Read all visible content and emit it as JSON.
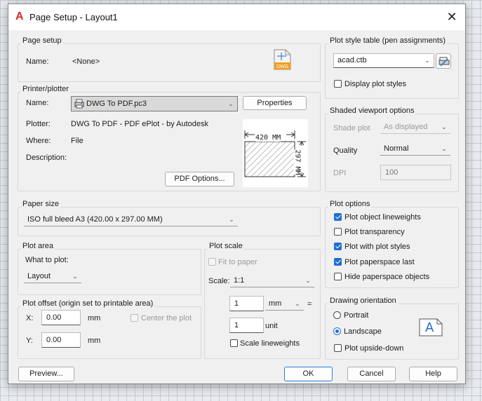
{
  "window": {
    "title": "Page Setup - Layout1",
    "logo": "A",
    "close_glyph": "✕"
  },
  "page_setup": {
    "group": "Page setup",
    "name_label": "Name:",
    "name_value": "<None>",
    "file_icon_text": "DWG"
  },
  "printer": {
    "group": "Printer/plotter",
    "name_label": "Name:",
    "name_value": "DWG To PDF.pc3",
    "properties_btn": "Properties",
    "plotter_label": "Plotter:",
    "plotter_value": "DWG To PDF - PDF ePlot - by Autodesk",
    "where_label": "Where:",
    "where_value": "File",
    "description_label": "Description:",
    "pdf_options_btn": "PDF Options...",
    "preview_width": "420  MM",
    "preview_height": "297  MM"
  },
  "paper_size": {
    "group": "Paper size",
    "value": "ISO full bleed A3 (420.00 x 297.00 MM)"
  },
  "plot_area": {
    "group": "Plot area",
    "what_label": "What to plot:",
    "value": "Layout"
  },
  "plot_scale": {
    "group": "Plot scale",
    "fit_label": "Fit to paper",
    "scale_label": "Scale:",
    "scale_value": "1:1",
    "mm_value": "1",
    "mm_unit": "mm",
    "equals": "=",
    "unit_value": "1",
    "unit_label": "unit",
    "scale_lw_label": "Scale lineweights"
  },
  "plot_offset": {
    "group": "Plot offset (origin set to printable area)",
    "x_label": "X:",
    "x_value": "0.00",
    "x_unit": "mm",
    "y_label": "Y:",
    "y_value": "0.00",
    "y_unit": "mm",
    "center_label": "Center the plot"
  },
  "plot_style": {
    "group": "Plot style table (pen assignments)",
    "value": "acad.ctb",
    "display_label": "Display plot styles"
  },
  "shaded": {
    "group": "Shaded viewport options",
    "shade_label": "Shade plot",
    "shade_value": "As displayed",
    "quality_label": "Quality",
    "quality_value": "Normal",
    "dpi_label": "DPI",
    "dpi_value": "100"
  },
  "plot_options": {
    "group": "Plot options",
    "items": [
      {
        "label": "Plot object lineweights",
        "checked": true
      },
      {
        "label": "Plot transparency",
        "checked": false
      },
      {
        "label": "Plot with plot styles",
        "checked": true
      },
      {
        "label": "Plot paperspace last",
        "checked": true
      },
      {
        "label": "Hide paperspace objects",
        "checked": false
      }
    ]
  },
  "orientation": {
    "group": "Drawing orientation",
    "portrait": "Portrait",
    "landscape": "Landscape",
    "selected": "Landscape",
    "upside_down": "Plot upside-down",
    "icon_letter": "A"
  },
  "footer": {
    "preview": "Preview...",
    "ok": "OK",
    "cancel": "Cancel",
    "help": "Help"
  },
  "colors": {
    "accent": "#1f6fd1",
    "logo_red": "#d22b2b",
    "dwg_orange": "#f0a020"
  }
}
